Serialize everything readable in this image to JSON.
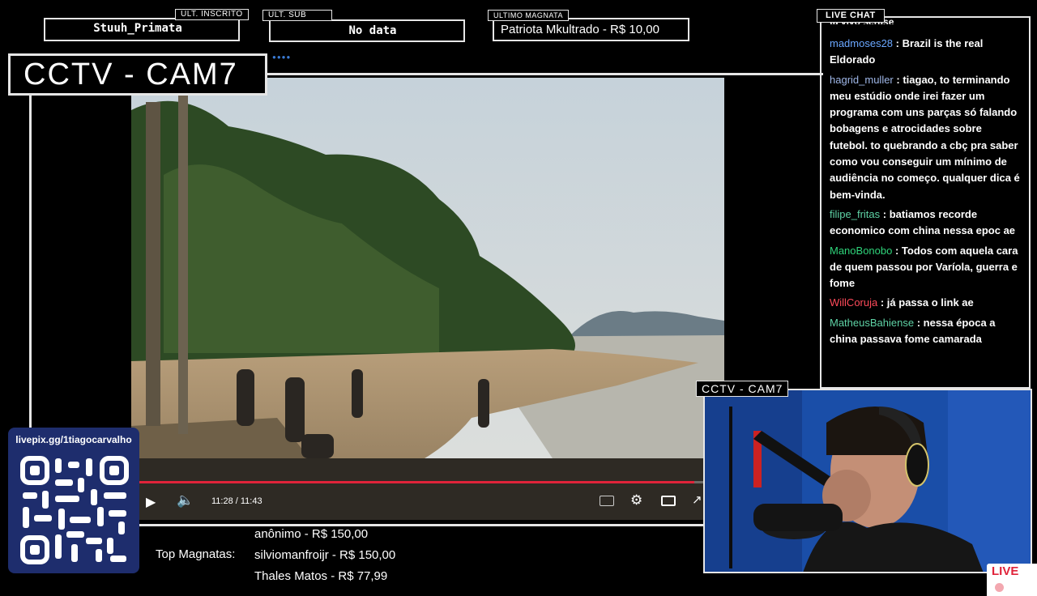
{
  "top": {
    "last_follow_label": "ULT. INSCRITO",
    "last_follow_value": "Stuuh_Primata",
    "last_sub_label": "ULT. SUB",
    "last_sub_value": "No data",
    "last_magnate_label": "ULTIMO MAGNATA",
    "last_magnate_value": "Patriota Mkultrado - R$ 10,00"
  },
  "cam_title": "CCTV - CAM7",
  "webcam_title": "CCTV - CAM7",
  "video": {
    "time": "11:28 / 11:43",
    "progress": 0.979
  },
  "chat": {
    "title": "LIVE CHAT",
    "partial_line": "ta vivo serase",
    "messages": [
      {
        "user": "madmoses28",
        "color": "#6aa7ff",
        "text": ": Brazil is the real Eldorado"
      },
      {
        "user": "hagrid_muller",
        "color": "#9fb7e8",
        "text": ": tiagao, to terminando meu estúdio onde irei fazer um programa com uns parças só falando bobagens e atrocidades sobre futebol. to quebrando a cbç pra saber como vou conseguir um mínimo de audiência no começo. qualquer dica é bem-vinda."
      },
      {
        "user": "filipe_fritas",
        "color": "#5fd3a6",
        "text": ": batiamos recorde economico com china nessa epoc ae"
      },
      {
        "user": "ManoBonobo",
        "color": "#2fd47a",
        "text": ": Todos com aquela cara de quem passou por Varíola, guerra e fome"
      },
      {
        "user": "WillCoruja",
        "color": "#ff4a5a",
        "text": ": já passa o link ae"
      },
      {
        "user": "MatheusBahiense",
        "color": "#5fd3a6",
        "text": ": nessa época a china passava fome camarada"
      }
    ]
  },
  "qr": {
    "url": "livepix.gg/1tiagocarvalho"
  },
  "magnatas": {
    "label": "Top Magnatas:",
    "entries": [
      "anônimo - R$ 150,00",
      "silviomanfroijr - R$ 150,00",
      "Thales Matos - R$ 77,99"
    ]
  },
  "live_badge": "LIVE",
  "colors": {
    "accent": "#e0233a",
    "frame": "#e6e6e6",
    "qr_bg": "#1e2d6d"
  }
}
